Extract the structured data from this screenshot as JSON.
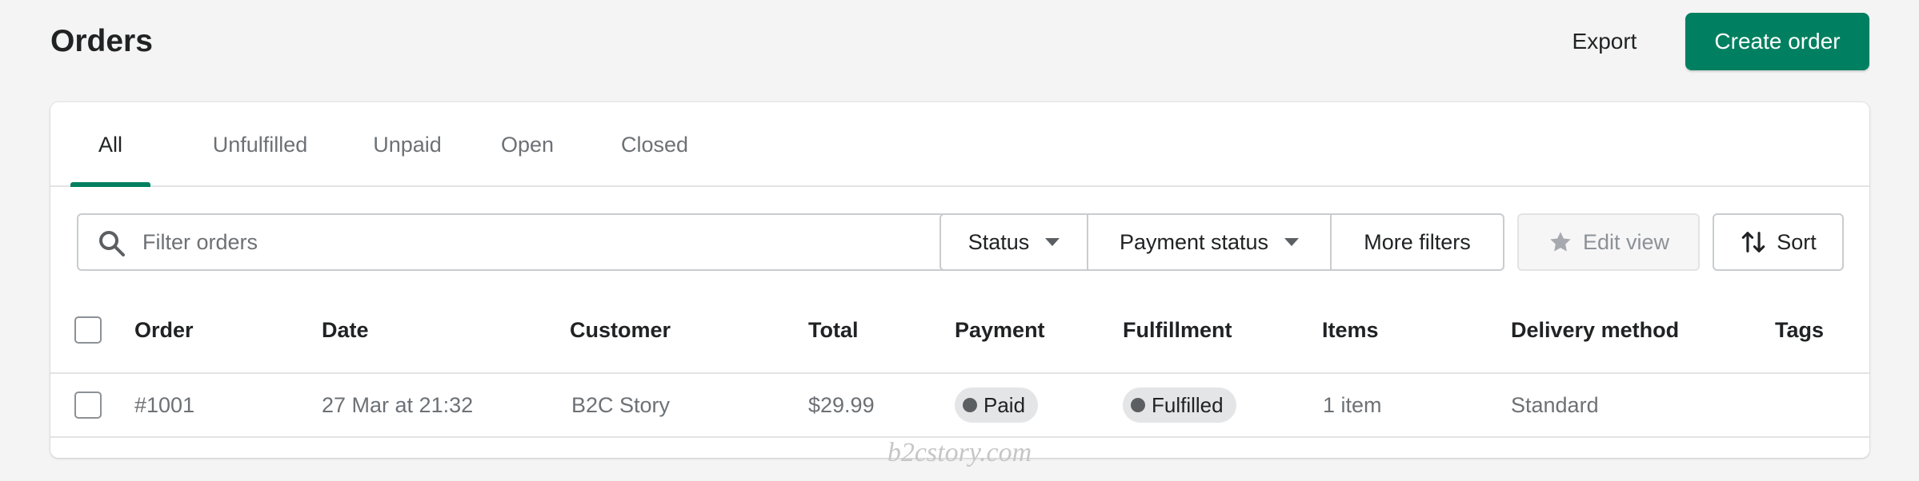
{
  "header": {
    "title": "Orders",
    "export_label": "Export",
    "create_label": "Create order"
  },
  "tabs": [
    {
      "label": "All",
      "active": true
    },
    {
      "label": "Unfulfilled",
      "active": false
    },
    {
      "label": "Unpaid",
      "active": false
    },
    {
      "label": "Open",
      "active": false
    },
    {
      "label": "Closed",
      "active": false
    }
  ],
  "filters": {
    "search_placeholder": "Filter orders",
    "search_value": "",
    "status_label": "Status",
    "payment_status_label": "Payment status",
    "more_filters_label": "More filters",
    "edit_view_label": "Edit view",
    "sort_label": "Sort"
  },
  "table": {
    "columns": [
      "Order",
      "Date",
      "Customer",
      "Total",
      "Payment",
      "Fulfillment",
      "Items",
      "Delivery method",
      "Tags"
    ],
    "rows": [
      {
        "order": "#1001",
        "date": "27 Mar at 21:32",
        "customer": "B2C Story",
        "total": "$29.99",
        "payment": "Paid",
        "fulfillment": "Fulfilled",
        "items": "1 item",
        "delivery": "Standard",
        "tags": ""
      }
    ]
  },
  "watermark": "b2cstory.com",
  "colors": {
    "accent": "#008060",
    "page_bg": "#f4f4f4",
    "badge_bg": "#e4e5e7"
  }
}
